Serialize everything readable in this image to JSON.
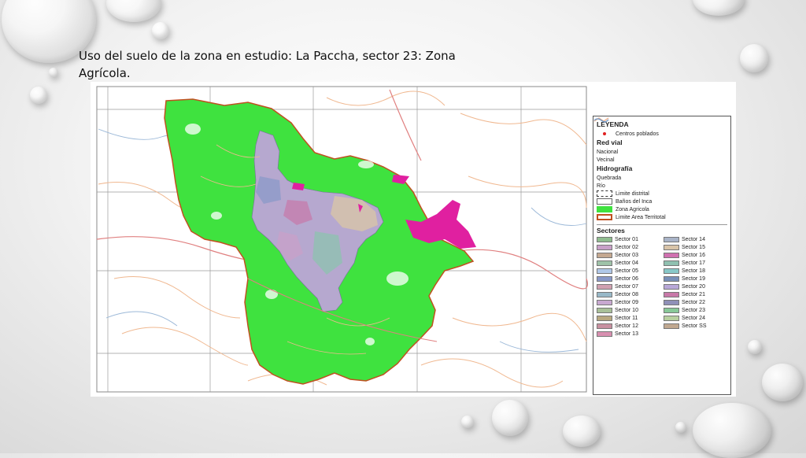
{
  "slide": {
    "title": "Uso del suelo de la zona en estudio: La Paccha, sector 23: Zona Agrícola."
  },
  "map": {
    "legend": {
      "title": "LEYENDA",
      "centros": "Centros poblados",
      "red_vial": {
        "heading": "Red vial",
        "nacional": "Nacional",
        "vecinal": "Vecinal"
      },
      "hidrografia": {
        "heading": "Hidrografía",
        "quebrada": "Quebrada",
        "rio": "Río",
        "limite_distrital": "Limite distrital",
        "banos": "Baños del Inca",
        "zona_agricola": "Zona Agricola",
        "limite_area": "Limite Area Territotal"
      },
      "sectores_heading": "Sectores",
      "sectores": [
        {
          "label": "Sector 01",
          "color": "#8fbc8f"
        },
        {
          "label": "Sector 14",
          "color": "#a9b4c8"
        },
        {
          "label": "Sector 02",
          "color": "#c8a0c8"
        },
        {
          "label": "Sector 15",
          "color": "#d8c4a8"
        },
        {
          "label": "Sector 03",
          "color": "#c4a890"
        },
        {
          "label": "Sector 16",
          "color": "#d070b0"
        },
        {
          "label": "Sector 04",
          "color": "#9fc2a8"
        },
        {
          "label": "Sector 17",
          "color": "#90c0b0"
        },
        {
          "label": "Sector 05",
          "color": "#b0c8e8"
        },
        {
          "label": "Sector 18",
          "color": "#88c8c8"
        },
        {
          "label": "Sector 06",
          "color": "#8898c8"
        },
        {
          "label": "Sector 19",
          "color": "#7890b8"
        },
        {
          "label": "Sector 07",
          "color": "#d0a0b0"
        },
        {
          "label": "Sector 20",
          "color": "#b8a8d8"
        },
        {
          "label": "Sector 08",
          "color": "#98b8c8"
        },
        {
          "label": "Sector 21",
          "color": "#c878a8"
        },
        {
          "label": "Sector 09",
          "color": "#c8a8d0"
        },
        {
          "label": "Sector 22",
          "color": "#9090b8"
        },
        {
          "label": "Sector 10",
          "color": "#a8c098"
        },
        {
          "label": "Sector 23",
          "color": "#88c898"
        },
        {
          "label": "Sector 11",
          "color": "#b8a880"
        },
        {
          "label": "Sector 24",
          "color": "#b8d0a0"
        },
        {
          "label": "Sector 12",
          "color": "#c890a0"
        },
        {
          "label": "Sector SS",
          "color": "#c0a890"
        },
        {
          "label": "Sector 13",
          "color": "#d890b0"
        }
      ]
    },
    "colors": {
      "agricultural": "#3fe23f",
      "urban": "#b6a8cf",
      "magenta": "#e020a0",
      "road_national": "#e08080",
      "road_vecinal": "#f0b890",
      "river": "#9bb8d8",
      "boundary": "#c05020"
    }
  }
}
